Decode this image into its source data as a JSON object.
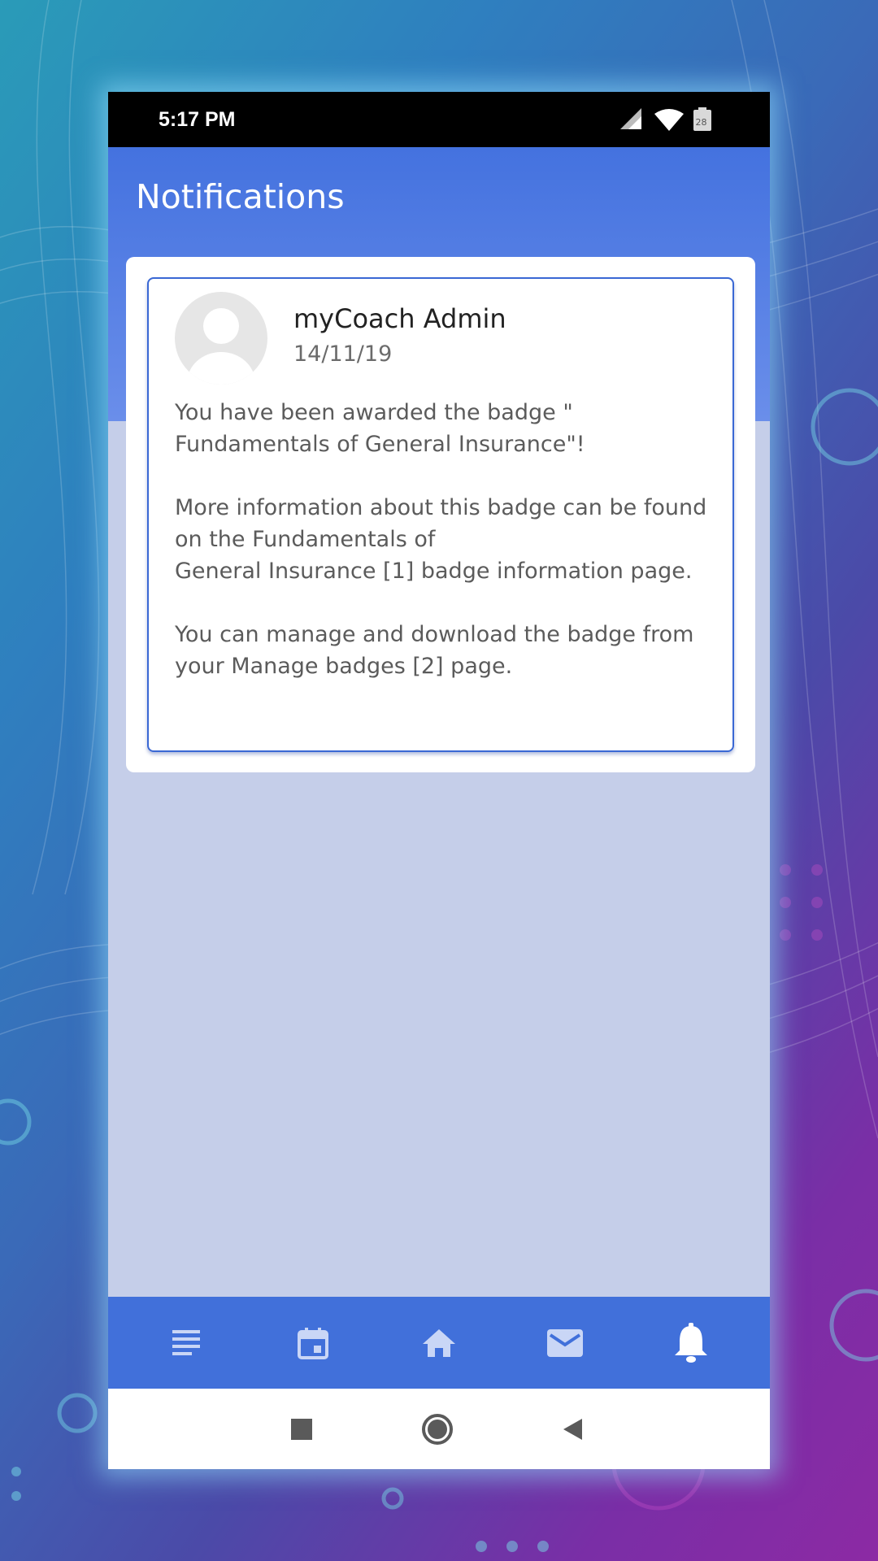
{
  "status_bar": {
    "time": "5:17 PM",
    "battery_level": "28",
    "icons": [
      "signal-icon",
      "wifi-icon",
      "battery-icon"
    ]
  },
  "header": {
    "title": "Notifications"
  },
  "notification": {
    "sender": "myCoach Admin",
    "date": "14/11/19",
    "paragraphs": [
      "You have been awarded the badge \"\nFundamentals of General Insurance\"!",
      "More information about this badge can be found on the Fundamentals of\nGeneral Insurance [1] badge information page.",
      "You can manage and download the badge from your Manage badges [2] page."
    ]
  },
  "bottom_nav": {
    "items": [
      "menu-icon",
      "calendar-icon",
      "home-icon",
      "mail-icon",
      "bell-icon"
    ],
    "active": "bell-icon"
  },
  "system_nav": {
    "buttons": [
      "recents-button",
      "home-button",
      "back-button"
    ]
  },
  "colors": {
    "primary": "#4170da",
    "content_background": "#c5cee9",
    "card_border": "#3a68d4"
  }
}
